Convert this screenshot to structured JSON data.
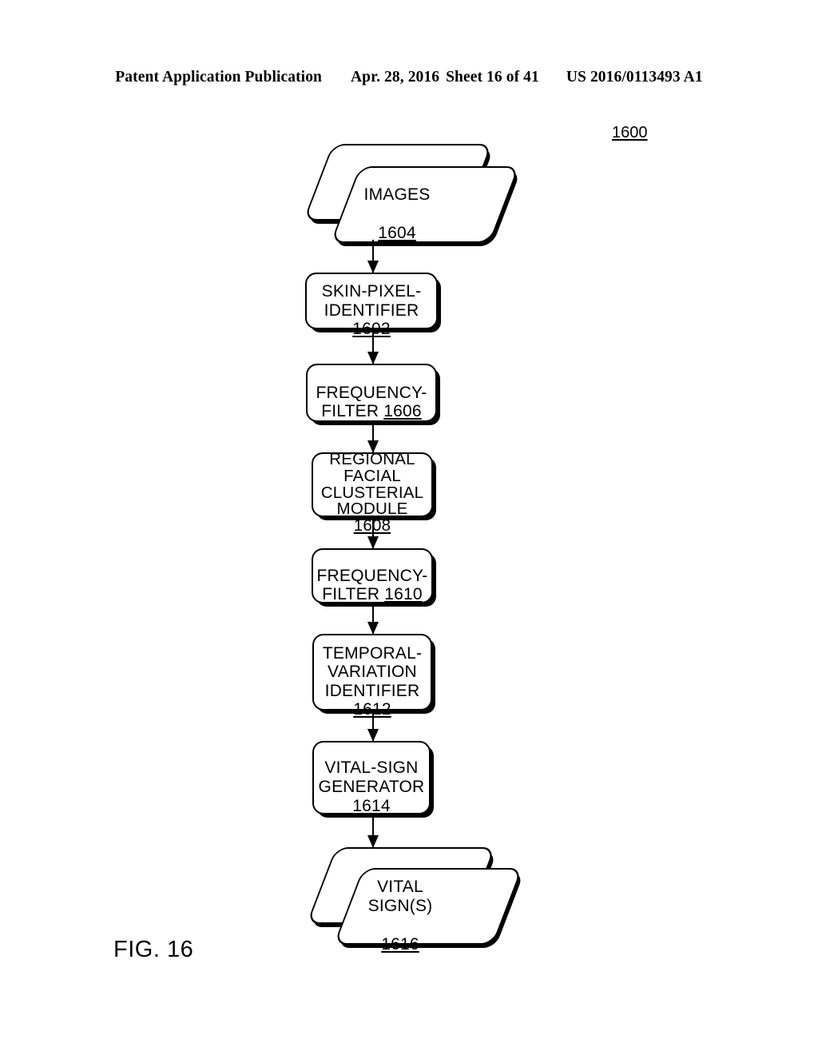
{
  "header": {
    "publication": "Patent Application Publication",
    "date": "Apr. 28, 2016",
    "sheet": "Sheet 16 of 41",
    "patent_number": "US 2016/0113493 A1"
  },
  "figure": {
    "caption": "FIG. 16",
    "reference_numeral": "1600"
  },
  "flowchart": {
    "nodes": [
      {
        "id": "images",
        "shape": "parallelogram-stack",
        "text": "IMAGES",
        "numeral": "1604"
      },
      {
        "id": "skin-pixel-identifier",
        "shape": "rounded-rect",
        "text": "SKIN-PIXEL-\nIDENTIFIER ",
        "numeral": "1602"
      },
      {
        "id": "frequency-filter-1606",
        "shape": "rounded-rect",
        "text": "FREQUENCY-\nFILTER  ",
        "numeral": "1606"
      },
      {
        "id": "regional-facial-clusterial-module",
        "shape": "rounded-rect",
        "text": "REGIONAL\nFACIAL\nCLUSTERIAL\nMODULE  ",
        "numeral": "1608"
      },
      {
        "id": "frequency-filter-1610",
        "shape": "rounded-rect",
        "text": "FREQUENCY-\nFILTER  ",
        "numeral": "1610"
      },
      {
        "id": "temporal-variation-identifier",
        "shape": "rounded-rect",
        "text": "TEMPORAL-\nVARIATION\nIDENTIFIER\n",
        "numeral": "1612"
      },
      {
        "id": "vital-sign-generator",
        "shape": "rounded-rect",
        "text": "VITAL-SIGN\nGENERATOR\n",
        "numeral": "1614"
      },
      {
        "id": "vital-signs",
        "shape": "parallelogram-stack",
        "text": "VITAL\nSIGN(S)",
        "numeral": "1616"
      }
    ],
    "connectors": [
      {
        "from": "images",
        "to": "skin-pixel-identifier"
      },
      {
        "from": "skin-pixel-identifier",
        "to": "frequency-filter-1606"
      },
      {
        "from": "frequency-filter-1606",
        "to": "regional-facial-clusterial-module"
      },
      {
        "from": "regional-facial-clusterial-module",
        "to": "frequency-filter-1610"
      },
      {
        "from": "frequency-filter-1610",
        "to": "temporal-variation-identifier"
      },
      {
        "from": "temporal-variation-identifier",
        "to": "vital-sign-generator"
      },
      {
        "from": "vital-sign-generator",
        "to": "vital-signs"
      }
    ]
  },
  "colors": {
    "ink": "#000000",
    "paper": "#ffffff"
  }
}
